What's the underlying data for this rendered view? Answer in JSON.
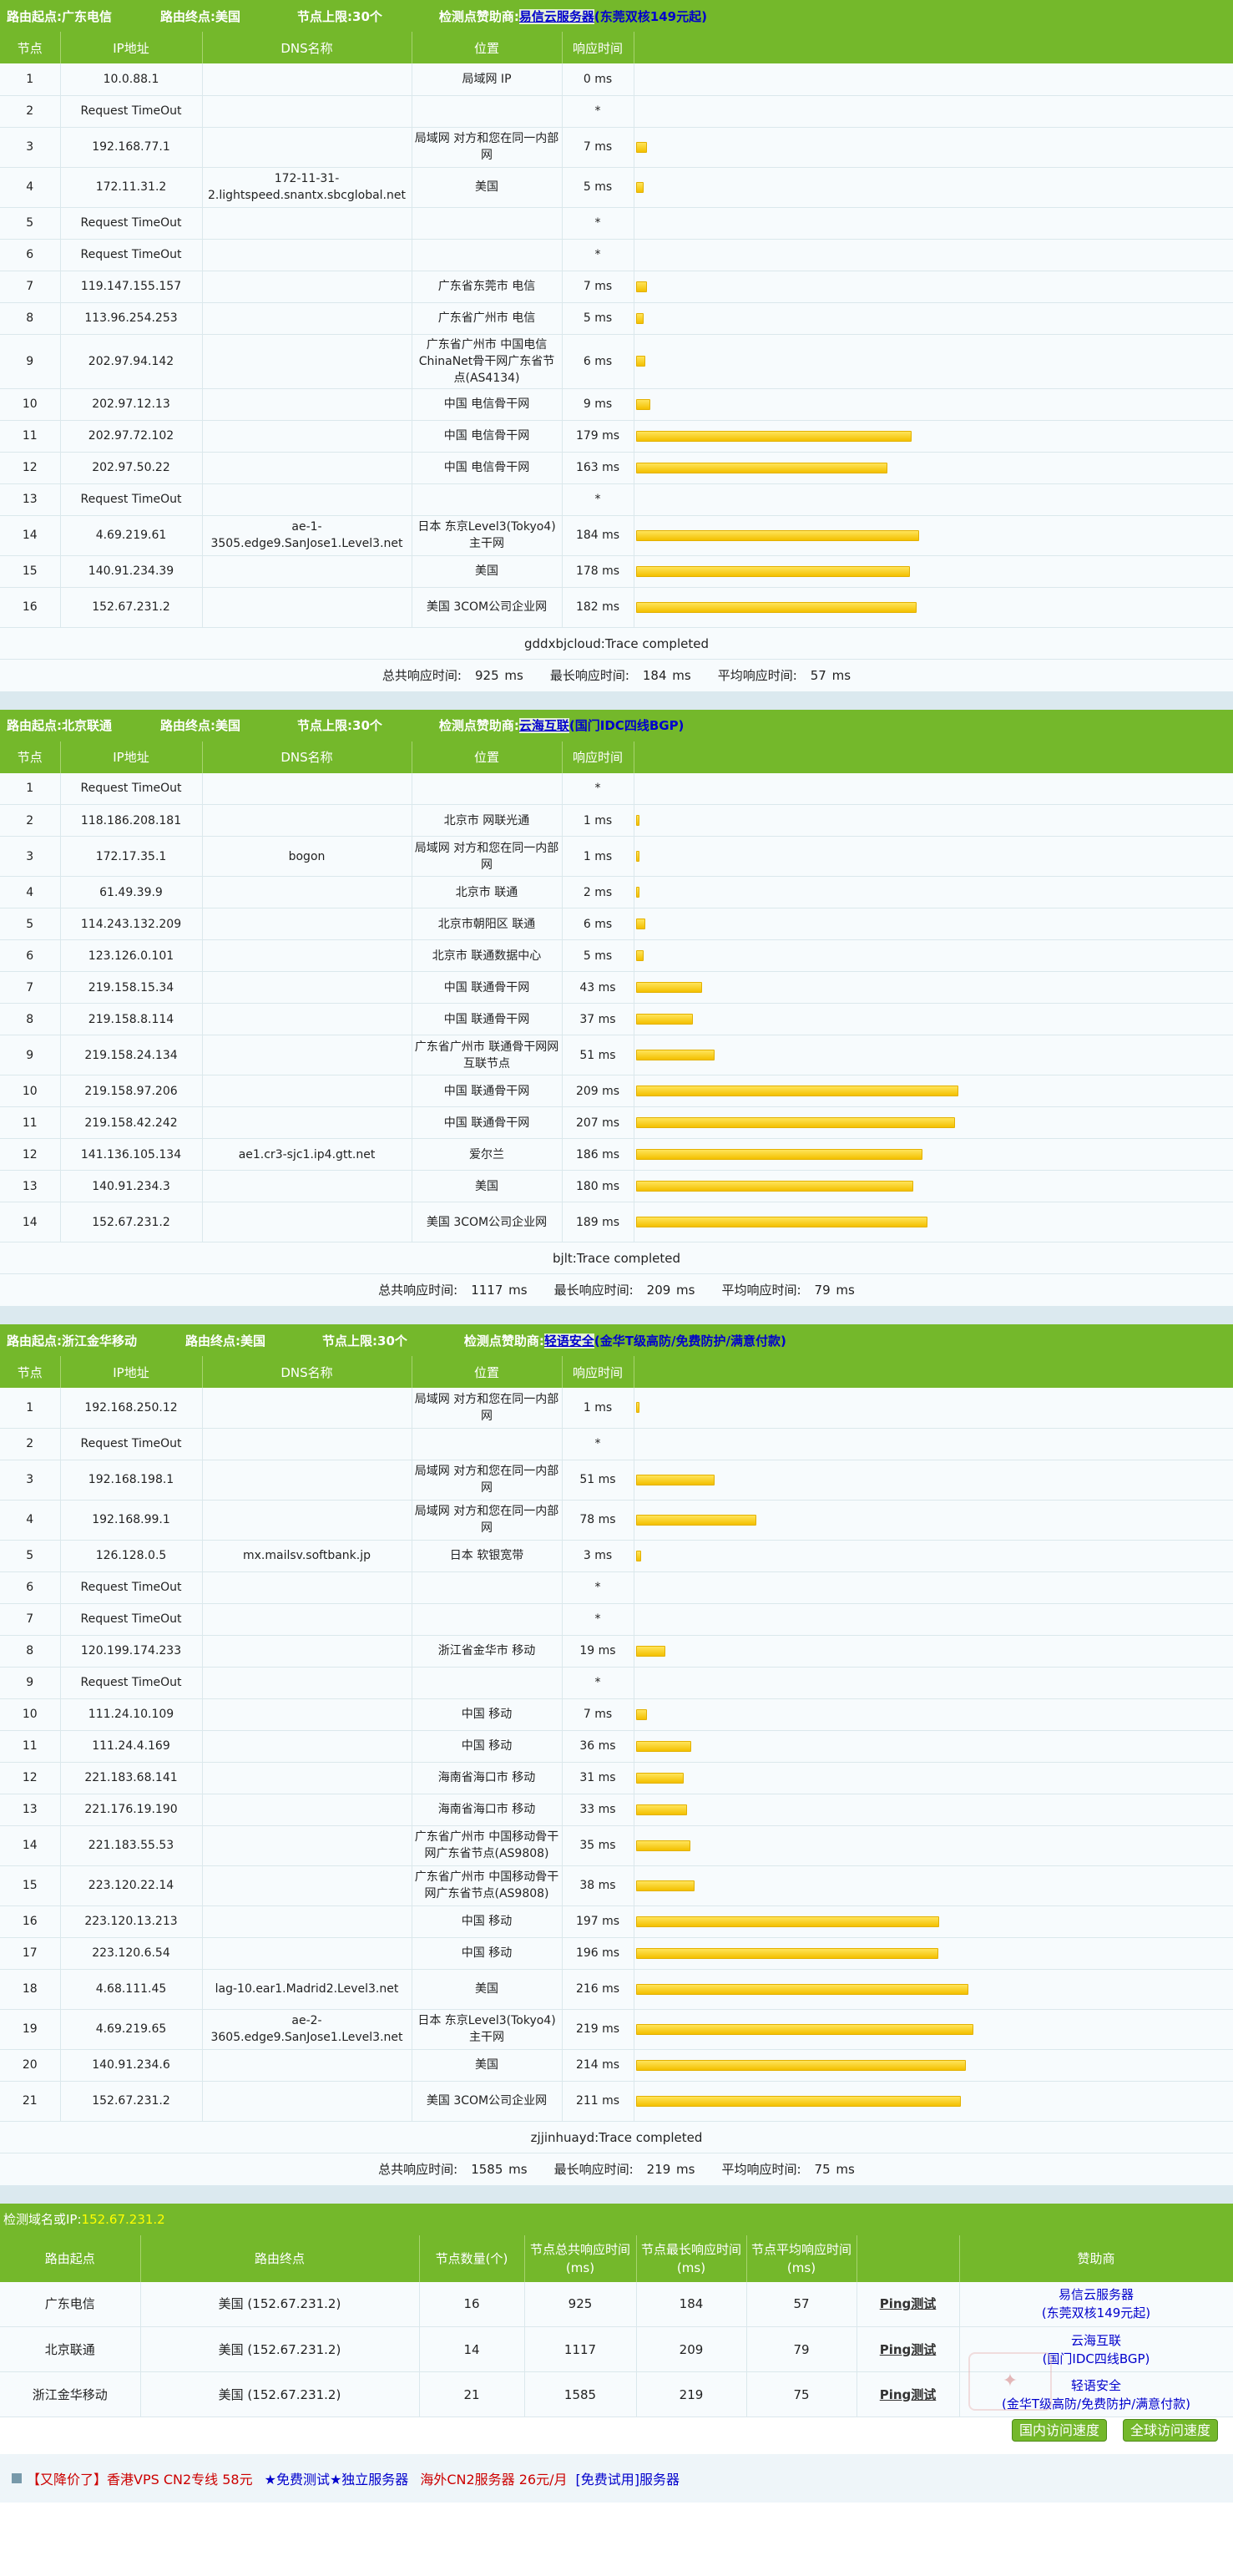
{
  "sections": [
    {
      "origin_label": "路由起点:",
      "origin": "广东电信",
      "end_label": "路由终点:",
      "end": "美国",
      "limit_label": "节点上限:",
      "limit": "30个",
      "sponsor_label": "检测点赞助商:",
      "sponsor": "易信云服务器",
      "sponsor_sub": "(东莞双核149元起)",
      "rows": [
        [
          "1",
          "10.0.88.1",
          "",
          "局域网 IP",
          "0 ms",
          0
        ],
        [
          "2",
          "Request TimeOut",
          "",
          "",
          "*",
          0
        ],
        [
          "3",
          "192.168.77.1",
          "",
          "局域网 对方和您在同一内部网",
          "7 ms",
          7
        ],
        [
          "4",
          "172.11.31.2",
          "172-11-31-2.lightspeed.snantx.sbcglobal.net",
          "美国",
          "5 ms",
          5
        ],
        [
          "5",
          "Request TimeOut",
          "",
          "",
          "*",
          0
        ],
        [
          "6",
          "Request TimeOut",
          "",
          "",
          "*",
          0
        ],
        [
          "7",
          "119.147.155.157",
          "",
          "广东省东莞市 电信",
          "7 ms",
          7
        ],
        [
          "8",
          "113.96.254.253",
          "",
          "广东省广州市 电信",
          "5 ms",
          5
        ],
        [
          "9",
          "202.97.94.142",
          "",
          "广东省广州市 中国电信ChinaNet骨干网广东省节点(AS4134)",
          "6 ms",
          6
        ],
        [
          "10",
          "202.97.12.13",
          "",
          "中国 电信骨干网",
          "9 ms",
          9
        ],
        [
          "11",
          "202.97.72.102",
          "",
          "中国 电信骨干网",
          "179 ms",
          179
        ],
        [
          "12",
          "202.97.50.22",
          "",
          "中国 电信骨干网",
          "163 ms",
          163
        ],
        [
          "13",
          "Request TimeOut",
          "",
          "",
          "*",
          0
        ],
        [
          "14",
          "4.69.219.61",
          "ae-1-3505.edge9.SanJose1.Level3.net",
          "日本 东京Level3(Tokyo4)主干网",
          "184 ms",
          184
        ],
        [
          "15",
          "140.91.234.39",
          "",
          "美国",
          "178 ms",
          178
        ],
        [
          "16",
          "152.67.231.2",
          "",
          "美国 3COM公司企业网",
          "182 ms",
          182
        ]
      ],
      "complete": "gddxbjcloud:Trace completed",
      "total_label": "总共响应时间:",
      "total": "925 ms",
      "max_label": "最长响应时间:",
      "max": "184 ms",
      "avg_label": "平均响应时间:",
      "avg": "57 ms"
    },
    {
      "origin_label": "路由起点:",
      "origin": "北京联通",
      "end_label": "路由终点:",
      "end": "美国",
      "limit_label": "节点上限:",
      "limit": "30个",
      "sponsor_label": "检测点赞助商:",
      "sponsor": "云海互联",
      "sponsor_sub": "(国门IDC四线BGP)",
      "rows": [
        [
          "1",
          "Request TimeOut",
          "",
          "",
          "*",
          0
        ],
        [
          "2",
          "118.186.208.181",
          "",
          "北京市 网联光通",
          "1 ms",
          1
        ],
        [
          "3",
          "172.17.35.1",
          "bogon",
          "局域网 对方和您在同一内部网",
          "1 ms",
          1
        ],
        [
          "4",
          "61.49.39.9",
          "",
          "北京市 联通",
          "2 ms",
          2
        ],
        [
          "5",
          "114.243.132.209",
          "",
          "北京市朝阳区 联通",
          "6 ms",
          6
        ],
        [
          "6",
          "123.126.0.101",
          "",
          "北京市 联通数据中心",
          "5 ms",
          5
        ],
        [
          "7",
          "219.158.15.34",
          "",
          "中国 联通骨干网",
          "43 ms",
          43
        ],
        [
          "8",
          "219.158.8.114",
          "",
          "中国 联通骨干网",
          "37 ms",
          37
        ],
        [
          "9",
          "219.158.24.134",
          "",
          "广东省广州市 联通骨干网网互联节点",
          "51 ms",
          51
        ],
        [
          "10",
          "219.158.97.206",
          "",
          "中国 联通骨干网",
          "209 ms",
          209
        ],
        [
          "11",
          "219.158.42.242",
          "",
          "中国 联通骨干网",
          "207 ms",
          207
        ],
        [
          "12",
          "141.136.105.134",
          "ae1.cr3-sjc1.ip4.gtt.net",
          "爱尔兰",
          "186 ms",
          186
        ],
        [
          "13",
          "140.91.234.3",
          "",
          "美国",
          "180 ms",
          180
        ],
        [
          "14",
          "152.67.231.2",
          "",
          "美国 3COM公司企业网",
          "189 ms",
          189
        ]
      ],
      "complete": "bjlt:Trace completed",
      "total_label": "总共响应时间:",
      "total": "1117 ms",
      "max_label": "最长响应时间:",
      "max": "209 ms",
      "avg_label": "平均响应时间:",
      "avg": "79 ms"
    },
    {
      "origin_label": "路由起点:",
      "origin": "浙江金华移动",
      "end_label": "路由终点:",
      "end": "美国",
      "limit_label": "节点上限:",
      "limit": "30个",
      "sponsor_label": "检测点赞助商:",
      "sponsor": "轻语安全",
      "sponsor_sub": "(金华T级高防/免费防护/满意付款)",
      "rows": [
        [
          "1",
          "192.168.250.12",
          "",
          "局域网 对方和您在同一内部网",
          "1 ms",
          1
        ],
        [
          "2",
          "Request TimeOut",
          "",
          "",
          "*",
          0
        ],
        [
          "3",
          "192.168.198.1",
          "",
          "局域网 对方和您在同一内部网",
          "51 ms",
          51
        ],
        [
          "4",
          "192.168.99.1",
          "",
          "局域网 对方和您在同一内部网",
          "78 ms",
          78
        ],
        [
          "5",
          "126.128.0.5",
          "mx.mailsv.softbank.jp",
          "日本 软银宽带",
          "3 ms",
          3
        ],
        [
          "6",
          "Request TimeOut",
          "",
          "",
          "*",
          0
        ],
        [
          "7",
          "Request TimeOut",
          "",
          "",
          "*",
          0
        ],
        [
          "8",
          "120.199.174.233",
          "",
          "浙江省金华市 移动",
          "19 ms",
          19
        ],
        [
          "9",
          "Request TimeOut",
          "",
          "",
          "*",
          0
        ],
        [
          "10",
          "111.24.10.109",
          "",
          "中国 移动",
          "7 ms",
          7
        ],
        [
          "11",
          "111.24.4.169",
          "",
          "中国 移动",
          "36 ms",
          36
        ],
        [
          "12",
          "221.183.68.141",
          "",
          "海南省海口市 移动",
          "31 ms",
          31
        ],
        [
          "13",
          "221.176.19.190",
          "",
          "海南省海口市 移动",
          "33 ms",
          33
        ],
        [
          "14",
          "221.183.55.53",
          "",
          "广东省广州市 中国移动骨干网广东省节点(AS9808)",
          "35 ms",
          35
        ],
        [
          "15",
          "223.120.22.14",
          "",
          "广东省广州市 中国移动骨干网广东省节点(AS9808)",
          "38 ms",
          38
        ],
        [
          "16",
          "223.120.13.213",
          "",
          "中国 移动",
          "197 ms",
          197
        ],
        [
          "17",
          "223.120.6.54",
          "",
          "中国 移动",
          "196 ms",
          196
        ],
        [
          "18",
          "4.68.111.45",
          "lag-10.ear1.Madrid2.Level3.net",
          "美国",
          "216 ms",
          216
        ],
        [
          "19",
          "4.69.219.65",
          "ae-2-3605.edge9.SanJose1.Level3.net",
          "日本 东京Level3(Tokyo4)主干网",
          "219 ms",
          219
        ],
        [
          "20",
          "140.91.234.6",
          "",
          "美国",
          "214 ms",
          214
        ],
        [
          "21",
          "152.67.231.2",
          "",
          "美国 3COM公司企业网",
          "211 ms",
          211
        ]
      ],
      "complete": "zjjinhuayd:Trace completed",
      "total_label": "总共响应时间:",
      "total": "1585 ms",
      "max_label": "最长响应时间:",
      "max": "219 ms",
      "avg_label": "平均响应时间:",
      "avg": "75 ms"
    }
  ],
  "headers": [
    "节点",
    "IP地址",
    "DNS名称",
    "位置",
    "响应时间"
  ],
  "summary": {
    "title": "检测域名或IP:",
    "ip": "152.67.231.2",
    "headers": [
      "路由起点",
      "路由终点",
      "节点数量(个)",
      "节点总共响应时间(ms)",
      "节点最长响应时间(ms)",
      "节点平均响应时间(ms)",
      "",
      "赞助商"
    ],
    "rows": [
      [
        "广东电信",
        "美国 (152.67.231.2)",
        "16",
        "925",
        "184",
        "57",
        "Ping测试",
        "易信云服务器",
        "(东莞双核149元起)"
      ],
      [
        "北京联通",
        "美国 (152.67.231.2)",
        "14",
        "1117",
        "209",
        "79",
        "Ping测试",
        "云海互联",
        "(国门IDC四线BGP)"
      ],
      [
        "浙江金华移动",
        "美国 (152.67.231.2)",
        "21",
        "1585",
        "219",
        "75",
        "Ping测试",
        "轻语安全",
        "(金华T级高防/免费防护/满意付款)"
      ]
    ]
  },
  "buttons": {
    "domestic": "国内访问速度",
    "global": "全球访问速度"
  },
  "footer": {
    "ad1": "【又降价了】香港VPS CN2专线 58元",
    "ad2": "★免费测试★独立服务器",
    "ad3": "海外CN2服务器 26元/月",
    "ad4": "[免费试用]服务器"
  }
}
